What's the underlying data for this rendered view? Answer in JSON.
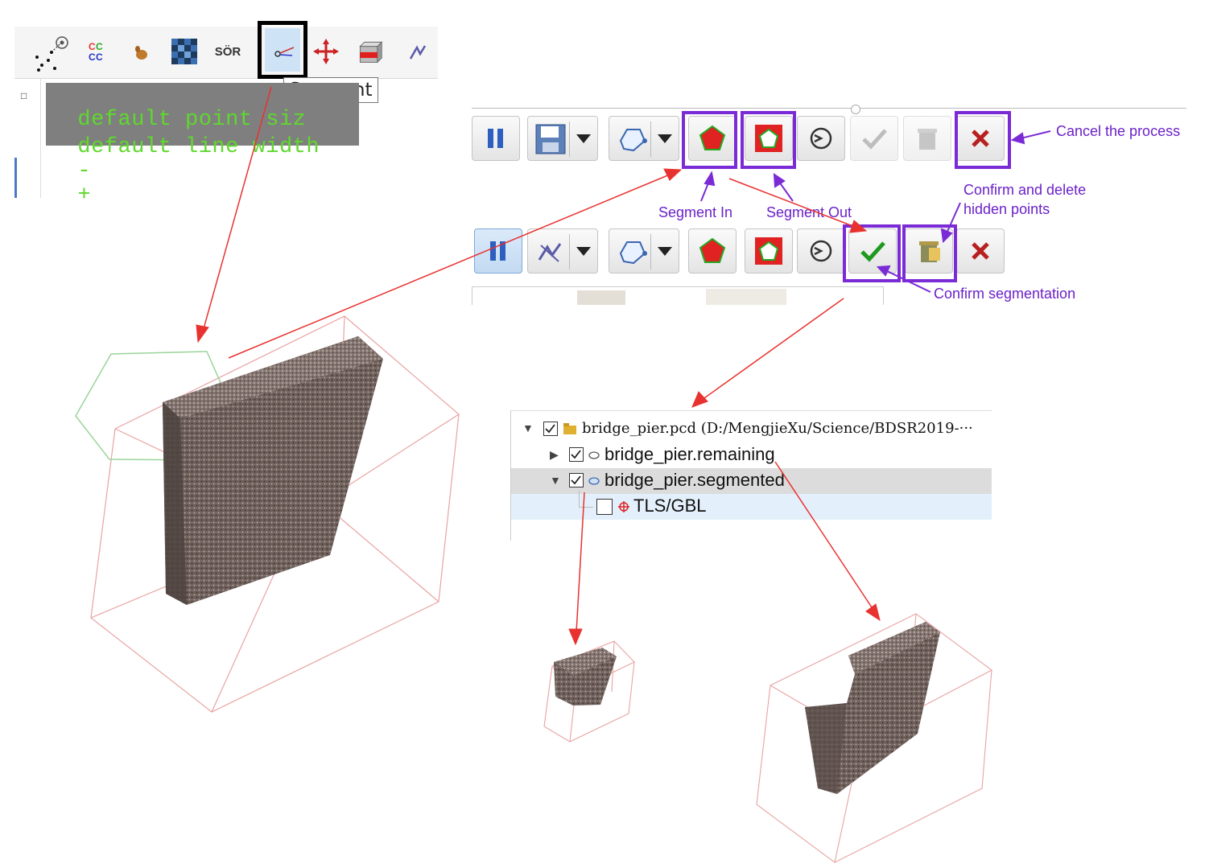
{
  "toolbar_top_left": {
    "tooltip": "Segment",
    "icons": [
      "point-cloud-icon",
      "cc-compare-icon",
      "bunny-icon",
      "checker-icon",
      "sor-filter-icon",
      "segment-scissors-icon",
      "translate-icon",
      "cross-section-icon",
      "pick-icon"
    ],
    "sor_label": "SÖR"
  },
  "overlay": {
    "line1": "default point siz",
    "line2": "default line width",
    "minus": "-",
    "plus": "+"
  },
  "annotations": {
    "cancel": "Cancel the process",
    "segment_in": "Segment In",
    "segment_out": "Segment Out",
    "confirm_delete_1": "Confirm and delete",
    "confirm_delete_2": "hidden points",
    "confirm_seg": "Confirm segmentation"
  },
  "tree": {
    "root": "bridge_pier.pcd (D:/MengjieXu/Science/BDSR2019-···",
    "child1": "bridge_pier.remaining",
    "child2": "bridge_pier.segmented",
    "grandchild": "TLS/GBL"
  },
  "colors": {
    "purple": "#7a2bd6",
    "arrow_red": "#e8322f",
    "overlay_green": "#5fd82e",
    "bbox_pink": "#e9a3a3"
  }
}
